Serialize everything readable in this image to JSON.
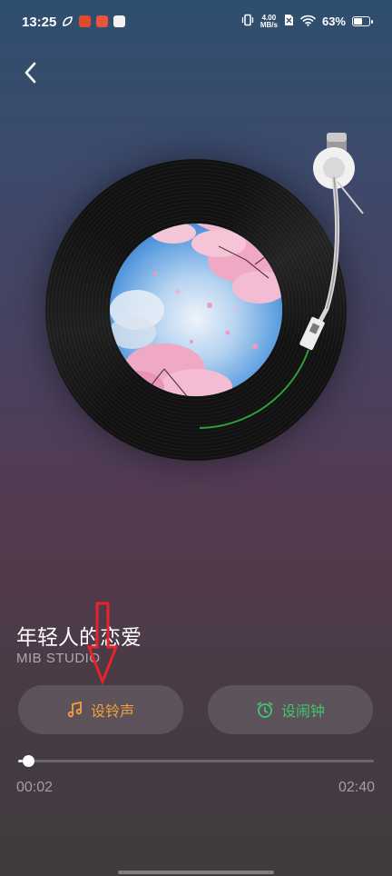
{
  "status_bar": {
    "time": "13:25",
    "network_speed_value": "4.00",
    "network_speed_unit": "MB/s",
    "battery_text": "63%",
    "battery_level": 0.63,
    "app_icons": [
      "leaf-app-icon",
      "red-app-icon",
      "orange-app-icon",
      "white-app-icon"
    ]
  },
  "player": {
    "progress_fraction": 0.013,
    "progress_arc_color": "#2e9d3a",
    "record_label_art": "cherry-blossom-sky-art"
  },
  "song": {
    "title": "年轻人的恋爱",
    "artist": "MIB STUDIO"
  },
  "actions": {
    "ringtone_label": "设铃声",
    "ringtone_color": "#f0a23a",
    "alarm_label": "设闹钟",
    "alarm_color": "#3fc76a"
  },
  "progress": {
    "current": "00:02",
    "total": "02:40"
  },
  "annotation": {
    "color": "#e8232b"
  }
}
